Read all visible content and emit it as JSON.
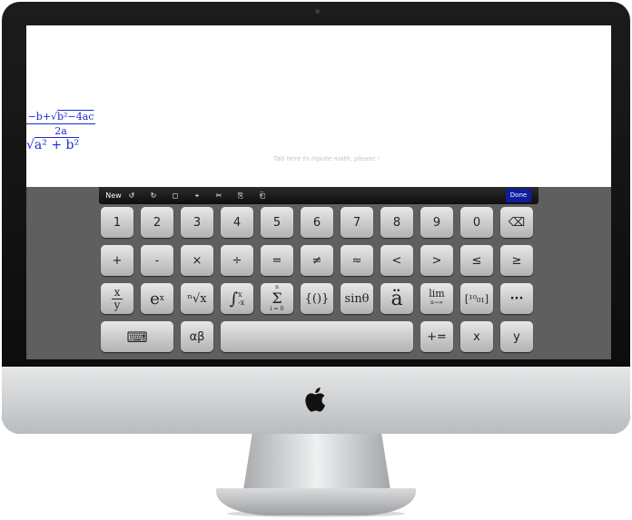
{
  "screen": {
    "placeholder": "Tab here to inpute math, please !",
    "equations": {
      "quadratic_numerator_prefix": "−b+√",
      "quadratic_numerator_radicand": "b²−4ac",
      "quadratic_denominator": "2a",
      "hypotenuse_radical": "√",
      "hypotenuse_radicand": "a² + b²"
    }
  },
  "toolbar": {
    "new_label": "New",
    "undo_icon": "↺",
    "redo_icon": "↻",
    "select_icon": "◻",
    "cursor_icon": "⌖",
    "cut_icon": "✂",
    "copy_icon": "⎘",
    "paste_icon": "⎗",
    "done_label": "Done"
  },
  "keyboard": {
    "row1": [
      "1",
      "2",
      "3",
      "4",
      "5",
      "6",
      "7",
      "8",
      "9",
      "0",
      "⌫"
    ],
    "row2": [
      "+",
      "-",
      "×",
      "÷",
      "=",
      "≠",
      "≈",
      "<",
      ">",
      "≤",
      "≥"
    ],
    "row3": {
      "fraction_num": "x",
      "fraction_den": "y",
      "exp_base": "e",
      "exp_power": "x",
      "nthroot": "ⁿ√x",
      "integral": "∫",
      "integral_upper": "x",
      "integral_lower": "-x",
      "sum_top": "n",
      "sum": "Σ",
      "sum_bottom": "i = 0",
      "braces": "{()}",
      "trig": "sinθ",
      "accent": "ä",
      "limit": "lim",
      "limit_sub": "n→∞",
      "matrix": "[¹⁰₀₁]",
      "more": "···"
    },
    "row4": {
      "keyboard_icon": "⌨",
      "greek": "αβ",
      "space": "",
      "plus_equals": "+=",
      "x": "x",
      "y": "y"
    }
  },
  "colors": {
    "math_blue": "#1b2bcf",
    "done_blue": "#0d1e9e",
    "keyboard_bg": "#5f5f5f"
  },
  "device": {
    "logo": "apple-icon"
  }
}
